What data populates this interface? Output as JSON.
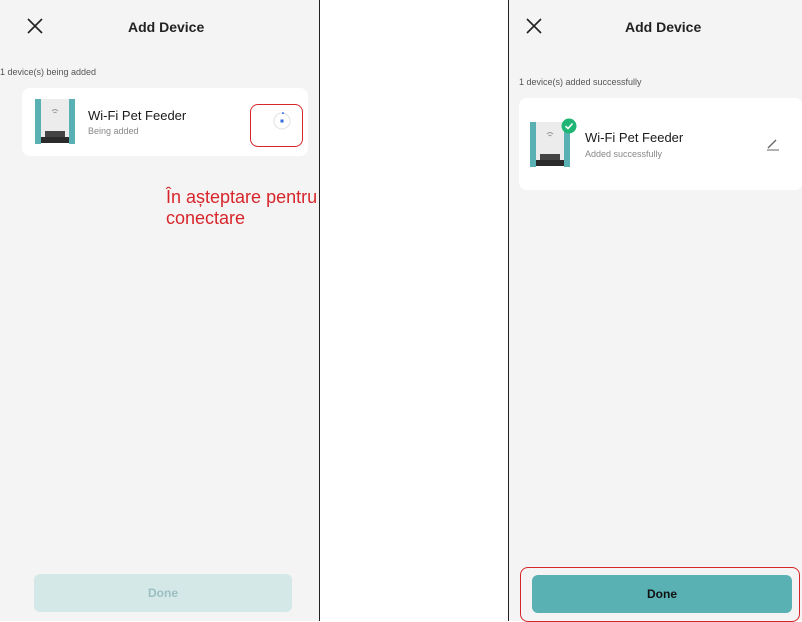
{
  "left": {
    "title": "Add Device",
    "status": "1 device(s) being added",
    "device": {
      "name": "Wi-Fi Pet Feeder",
      "status": "Being added"
    },
    "done_label": "Done"
  },
  "right": {
    "title": "Add Device",
    "status": "1 device(s) added successfully",
    "device": {
      "name": "Wi-Fi Pet Feeder",
      "status": "Added successfully"
    },
    "done_label": "Done"
  },
  "annotation": {
    "text": "În așteptare pentru conectare"
  },
  "colors": {
    "accent": "#5ab1b3",
    "accent_disabled": "#d5e8e8",
    "callout": "#d7262b",
    "success": "#20b574",
    "loading": "#2f6de0"
  },
  "icons": [
    "close-icon",
    "device-image",
    "loading-icon",
    "success-check-icon",
    "edit-icon"
  ]
}
